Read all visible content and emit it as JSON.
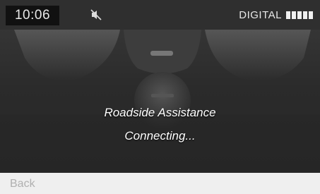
{
  "status_bar": {
    "time": "10:06",
    "mute_icon": "speaker-muted-icon",
    "signal_label": "DIGITAL",
    "signal_bars": 5,
    "signal_level": 1.0
  },
  "dialog": {
    "title": "Roadside Assistance",
    "status": "Connecting..."
  },
  "softkeys": {
    "back_label": "Back"
  },
  "colors": {
    "text": "#ffffff",
    "background": "#2b2b2b",
    "softbar": "#efefef",
    "softkey_text": "#b0b0b0"
  }
}
